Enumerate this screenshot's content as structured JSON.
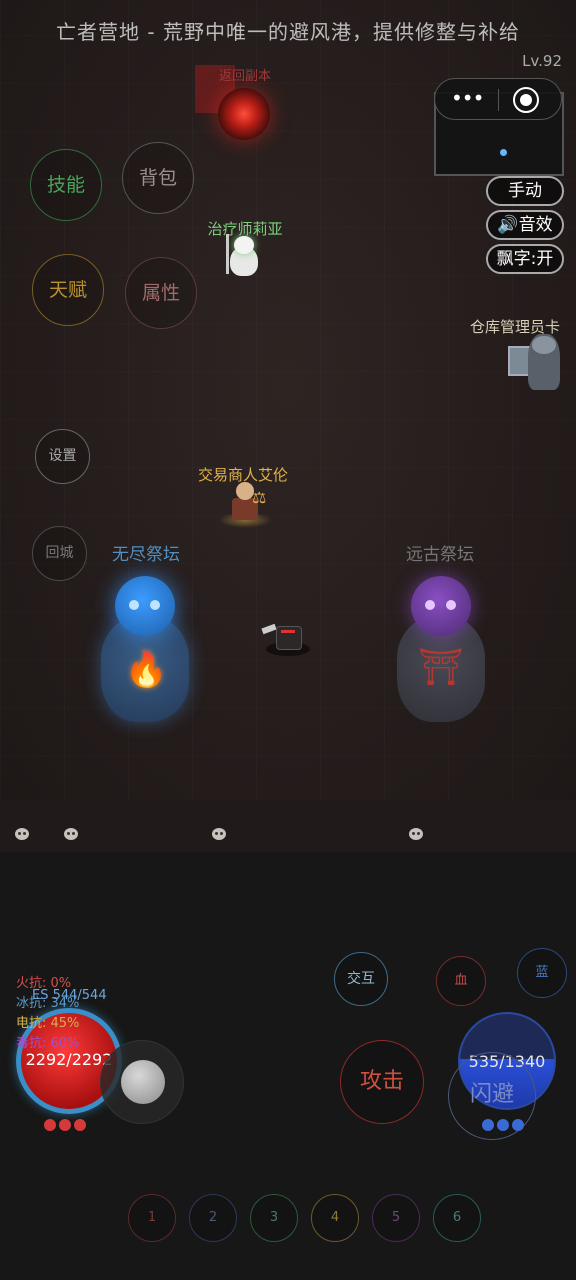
{
  "header": {
    "title": "亡者营地 - 荒野中唯一的避风港，提供修整与补给",
    "level": "Lv.92"
  },
  "toggles": {
    "manual": "手动",
    "sound": "🔊音效",
    "floating_text": "飘字:开"
  },
  "left_menu": {
    "skills": "技能",
    "bag": "背包",
    "talent": "天赋",
    "attributes": "属性",
    "settings": "设置",
    "return_town": "回城"
  },
  "map": {
    "portal_label": "返回副本",
    "npcs": {
      "healer": "治疗师莉亚",
      "warehouse_keeper": "仓库管理员卡",
      "trader": "交易商人艾伦"
    },
    "altars": {
      "endless": "无尽祭坛",
      "ancient": "远古祭坛"
    }
  },
  "player": {
    "resistances": {
      "fire": "火抗: 0%",
      "ice": "冰抗: 34%",
      "lightning": "电抗: 45%",
      "poison": "毒抗: 60%"
    },
    "energy_shield": "ES 544/544",
    "hp": "2292/2292",
    "mp": "535/1340"
  },
  "actions": {
    "interact": "交互",
    "hp_potion": "血",
    "mp_potion": "蓝",
    "attack": "攻击",
    "dodge": "闪避"
  },
  "hotbar": [
    "1",
    "2",
    "3",
    "4",
    "5",
    "6"
  ],
  "colors": {
    "hp_orb": "#d32a2a",
    "mp_orb": "#2a4fd8",
    "shield_ring": "#3a8fc8",
    "trader_name": "#e3b24a",
    "healer_name": "#7fcf7f"
  }
}
